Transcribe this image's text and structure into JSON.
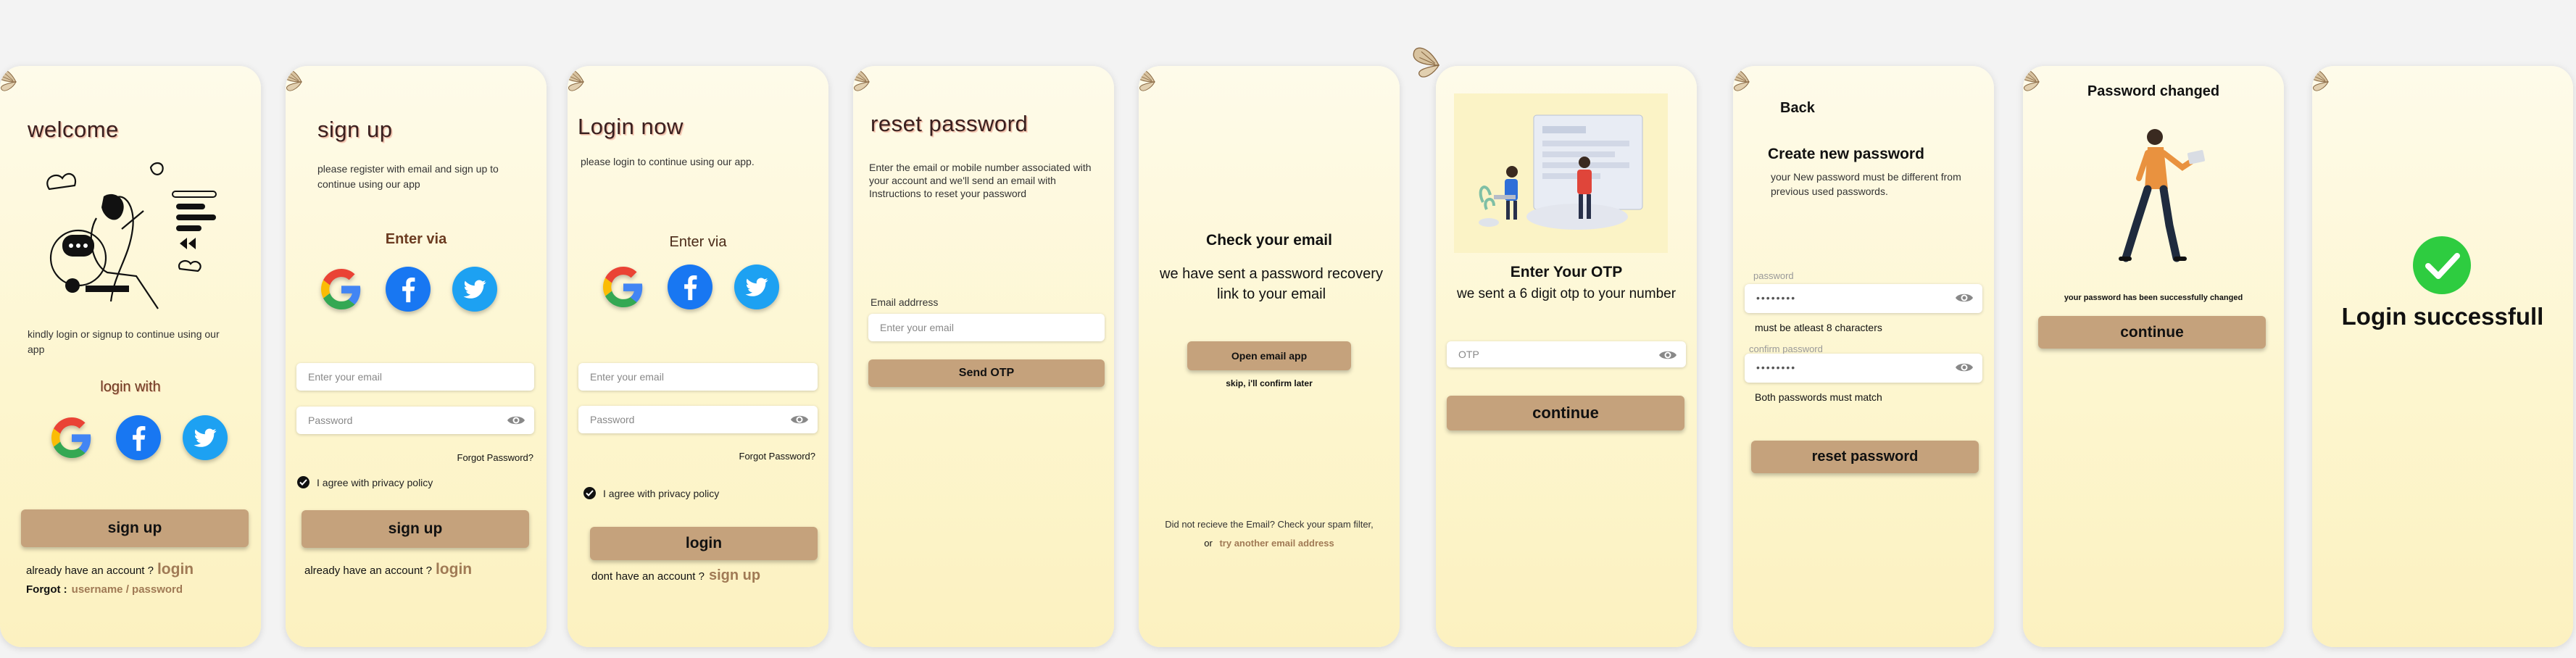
{
  "screens": {
    "welcome": {
      "title": "welcome",
      "desc": "kindly login or signup to continue using our app",
      "login_with": "login with",
      "signup_btn": "sign up",
      "have_account": "already have an account ?",
      "login_link": "login",
      "forgot_label": "Forgot :",
      "forgot_link": "username / password"
    },
    "signup": {
      "title": "sign up",
      "desc": "please register with email and sign up to continue using our app",
      "enter_via": "Enter via",
      "email_ph": "Enter your email",
      "password_ph": "Password",
      "forgot": "Forgot Password?",
      "agree": "I agree with privacy policy",
      "btn": "sign up",
      "have_account": "already have an account ?",
      "login_link": "login"
    },
    "login": {
      "title": "Login now",
      "desc": "please login to continue using our app.",
      "enter_via": "Enter via",
      "email_ph": "Enter your email",
      "password_ph": "Password",
      "forgot": "Forgot Password?",
      "agree": "I agree with privacy policy",
      "btn": "login",
      "no_account": "dont have an account ?",
      "signup_link": "sign up"
    },
    "reset": {
      "title": "reset password",
      "desc": "Enter the email or mobile number associated with your account and we'll send an email with Instructions to reset your password",
      "email_label": "Email addrress",
      "email_ph": "Enter your email",
      "btn": "Send OTP"
    },
    "check_email": {
      "title": "Check your email",
      "desc": "we have sent a  password recovery link to your email",
      "btn": "Open email app",
      "skip": "skip, i'll confirm later",
      "footer1": "Did not recieve the Email? Check your spam filter,",
      "footer_or": "or",
      "footer_link": "try another email address"
    },
    "otp": {
      "title": "Enter Your OTP",
      "desc": "we sent a 6 digit otp to your number",
      "otp_ph": "OTP",
      "btn": "continue"
    },
    "new_password": {
      "back": "Back",
      "title": "Create new password",
      "desc": "your New password must be different from previous used passwords.",
      "pw_label": "password",
      "pw_value": "••••••••",
      "pw_hint": "must be atleast 8 characters",
      "confirm_label": "confirm password",
      "confirm_value": "••••••••",
      "confirm_hint": "Both passwords must match",
      "btn": "reset password"
    },
    "changed": {
      "title": "Password changed",
      "msg": "your password has been successfully changed",
      "btn": "continue"
    },
    "success": {
      "title": "Login successfull"
    }
  },
  "icons": [
    "moth-icon",
    "google-icon",
    "facebook-icon",
    "twitter-icon",
    "eye-icon",
    "check-icon"
  ],
  "colors": {
    "button": "#c5a27c",
    "card_top": "#fefbea",
    "card_bottom": "#fcf1c0",
    "link": "#a07a55",
    "success": "#2ecc40",
    "facebook": "#1877f2",
    "twitter": "#1da1f2"
  }
}
